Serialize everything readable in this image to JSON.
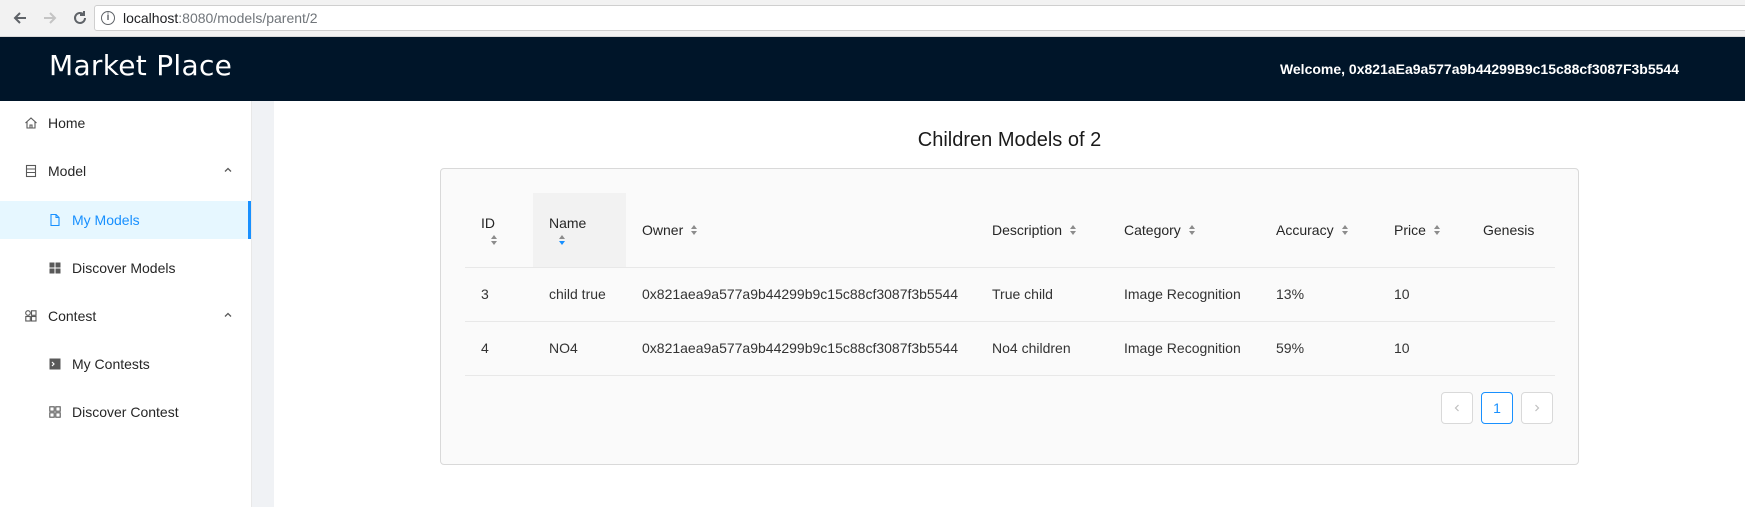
{
  "browser": {
    "host": "localhost",
    "path": ":8080/models/parent/2"
  },
  "header": {
    "logo": "Market Place",
    "welcome": "Welcome, 0x821aEa9a577a9b44299B9c15c88cf3087F3b5544"
  },
  "sidebar": {
    "items": [
      {
        "label": "Home",
        "icon": "home-icon"
      },
      {
        "label": "Model",
        "icon": "database-icon",
        "expanded": true
      },
      {
        "label": "My Models",
        "icon": "file-icon",
        "active": true
      },
      {
        "label": "Discover Models",
        "icon": "grid-icon"
      },
      {
        "label": "Contest",
        "icon": "contest-icon",
        "expanded": true
      },
      {
        "label": "My Contests",
        "icon": "terminal-icon"
      },
      {
        "label": "Discover Contest",
        "icon": "appstore-icon"
      }
    ]
  },
  "main": {
    "title": "Children Models of 2",
    "table": {
      "columns": [
        "ID",
        "Name",
        "Owner",
        "Description",
        "Category",
        "Accuracy",
        "Price",
        "Genesis"
      ],
      "rows": [
        {
          "id": "3",
          "name": "child true",
          "owner": "0x821aea9a577a9b44299b9c15c88cf3087f3b5544",
          "description": "True child",
          "category": "Image Recognition",
          "accuracy": "13%",
          "price": "10",
          "genesis": ""
        },
        {
          "id": "4",
          "name": "NO4",
          "owner": "0x821aea9a577a9b44299b9c15c88cf3087f3b5544",
          "description": "No4 children",
          "category": "Image Recognition",
          "accuracy": "59%",
          "price": "10",
          "genesis": ""
        }
      ]
    },
    "pagination": {
      "current": "1"
    }
  },
  "colors": {
    "header_bg": "#001529",
    "accent": "#1890ff",
    "active_bg": "#e6f7ff"
  }
}
